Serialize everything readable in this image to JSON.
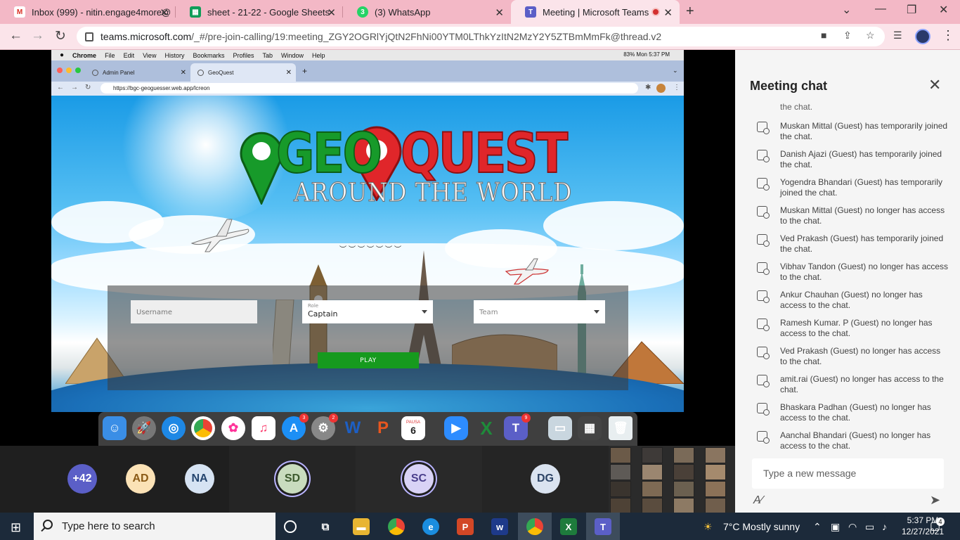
{
  "browser": {
    "tabs": [
      {
        "label": "Inbox (999) - nitin.engage4more@",
        "icon": "gmail-icon"
      },
      {
        "label": "sheet - 21-22 - Google Sheets",
        "icon": "sheets-icon"
      },
      {
        "label": "(3) WhatsApp",
        "icon": "whatsapp-icon"
      },
      {
        "label": "Meeting | Microsoft Teams",
        "icon": "teams-icon"
      }
    ],
    "url_main": "teams.microsoft.com",
    "url_rest": "/_#/pre-join-calling/19:meeting_ZGY2OGRlYjQtN2FhNi00YTM0LThkYzItN2MzY2Y5ZTBmMmFk@thread.v2"
  },
  "mac": {
    "menu": [
      "Chrome",
      "File",
      "Edit",
      "View",
      "History",
      "Bookmarks",
      "Profiles",
      "Tab",
      "Window",
      "Help"
    ],
    "status": "83%  Mon 5:37 PM",
    "tabs": [
      "Admin Panel",
      "GeoQuest"
    ],
    "url": "https://bgc-geoguesser.web.app/lcreon"
  },
  "game": {
    "logo_geo": "GEO",
    "logo_quest": "QUEST",
    "logo_sub": "AROUND THE WORLD",
    "username_placeholder": "Username",
    "role_label": "Role",
    "role_value": "Captain",
    "team_placeholder": "Team",
    "play_label": "PLAY"
  },
  "dock": {
    "badges": {
      "appstore": "3",
      "settings": "2",
      "calendar": "6",
      "teams": "9"
    },
    "calendar_month": "PAUSA"
  },
  "chat": {
    "title": "Meeting chat",
    "partial_top": "the chat.",
    "messages": [
      "Muskan Mittal (Guest) has temporarily joined the chat.",
      "Danish Ajazi (Guest) has temporarily joined the chat.",
      "Yogendra Bhandari (Guest) has temporarily joined the chat.",
      "Muskan Mittal (Guest) no longer has access to the chat.",
      "Ved Prakash (Guest) has temporarily joined the chat.",
      "Vibhav Tandon (Guest) no longer has access to the chat.",
      "Ankur Chauhan (Guest) no longer has access to the chat.",
      "Ramesh Kumar. P (Guest) no longer has access to the chat.",
      "Ved Prakash (Guest) no longer has access to the chat.",
      "amit.rai (Guest) no longer has access to the chat.",
      "Bhaskara Padhan (Guest) no longer has access to the chat.",
      "Aanchal Bhandari (Guest) no longer has access to the chat."
    ],
    "input_placeholder": "Type a new message"
  },
  "participants": [
    {
      "initials": "+42",
      "bg": "#5b5fc7",
      "fg": "#ffffff"
    },
    {
      "initials": "AD",
      "bg": "#fbe2b6",
      "fg": "#8a5a16"
    },
    {
      "initials": "NA",
      "bg": "#d6e3f3",
      "fg": "#24446e"
    },
    {
      "initials": "SD",
      "bg": "#c9dcbe",
      "fg": "#3d5a2e"
    },
    {
      "initials": "SC",
      "bg": "#d9d3f6",
      "fg": "#4a3f8c"
    },
    {
      "initials": "DG",
      "bg": "#dae3f0",
      "fg": "#2d4466"
    }
  ],
  "taskbar": {
    "search_placeholder": "Type here to search",
    "weather": "7°C  Mostly sunny",
    "time": "5:37 PM",
    "date": "12/27/2021",
    "notifications": "4"
  }
}
